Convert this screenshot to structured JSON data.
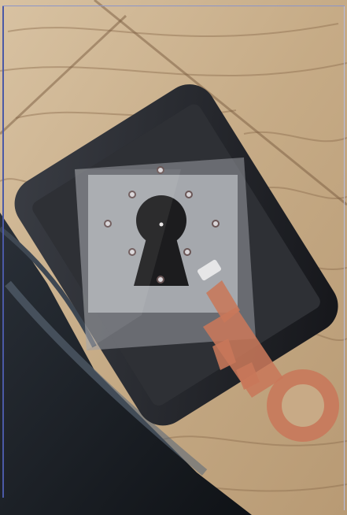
{
  "photo": {
    "subject": "",
    "screen_caption": "",
    "screen_badge_text": ""
  },
  "colors": {
    "table_wood": "#c9b08d",
    "wood_grain": "#8b6c4e",
    "phone_body": "#0f0f12",
    "overlay_panel": "#8d8f95",
    "keyhole": "#1c1c1e",
    "key_copper": "#c8775a",
    "chair_dark": "#1b1f26"
  },
  "icons": [
    "keyhole-icon",
    "key-icon",
    "unlock-dot-icon"
  ]
}
